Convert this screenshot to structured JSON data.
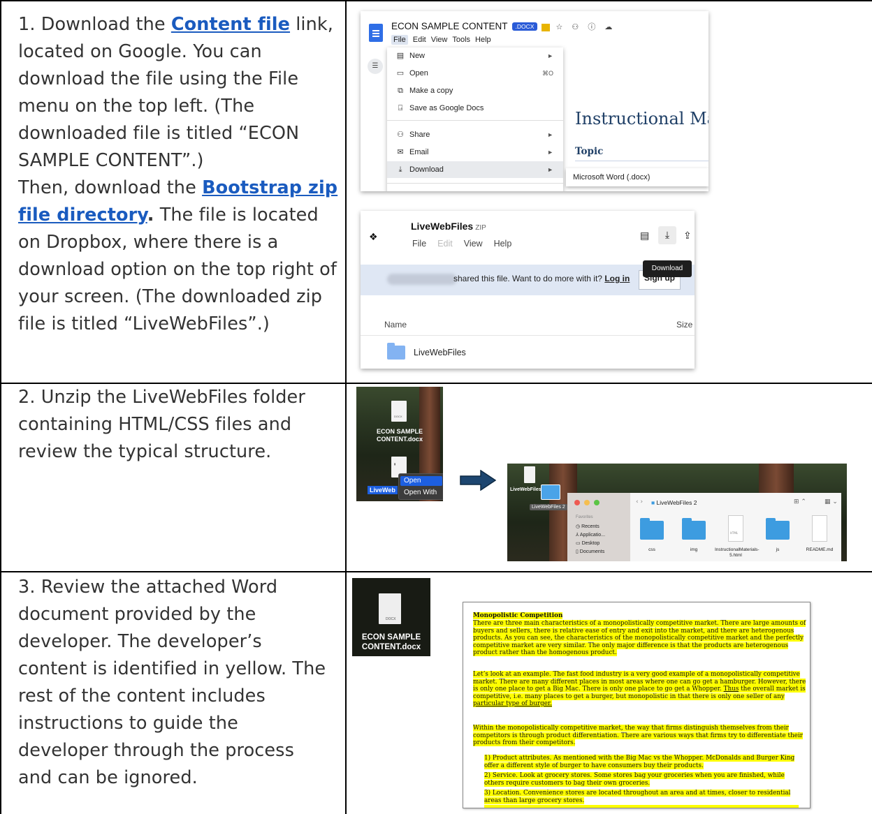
{
  "rows": [
    {
      "step": {
        "t1": "1. Download the ",
        "link1": "Content file",
        "t2": " link, located on Google. You can download the file using the File menu on the top left.  (The downloaded file is titled “ECON SAMPLE CONTENT”.)",
        "t3": "Then, download the ",
        "link2": "Bootstrap zip file directory",
        "t4": ".",
        "t5": "  The file is located on Dropbox, where there is a download option on the top right of your screen. (The downloaded zip file is titled “LiveWebFiles”.)"
      }
    },
    {
      "step": {
        "text": "2. Unzip the LiveWebFiles folder containing HTML/CSS files and review the typical structure."
      }
    },
    {
      "step": {
        "text": "3. Review the attached Word document provided by the developer. The developer’s content is identified in yellow. The rest of the content includes instructions to guide the developer through the process and can be ignored."
      }
    }
  ],
  "gdocs": {
    "title": "ECON SAMPLE CONTENT",
    "badge": ".DOCX",
    "menubar": [
      "File",
      "Edit",
      "View",
      "Tools",
      "Help"
    ],
    "menu": [
      {
        "icon": "▤",
        "label": "New",
        "right": "►"
      },
      {
        "icon": "▭",
        "label": "Open",
        "right": "⌘O"
      },
      {
        "icon": "⧉",
        "label": "Make a copy",
        "right": ""
      },
      {
        "icon": "⍈",
        "label": "Save as Google Docs",
        "right": ""
      },
      {
        "icon": "⚇",
        "label": "Share",
        "right": "►"
      },
      {
        "icon": "✉",
        "label": "Email",
        "right": "►"
      },
      {
        "icon": "⤓",
        "label": "Download",
        "right": "►"
      }
    ],
    "doc_heading": "Instructional Ma",
    "doc_topic": "Topic",
    "submenu_item": "Microsoft Word (.docx)"
  },
  "dropbox": {
    "name": "LiveWebFiles",
    "zip": "ZIP",
    "menu": [
      "File",
      "Edit",
      "View",
      "Help"
    ],
    "tooltip": "Download",
    "banner_text": "shared this file. Want to do more with it?",
    "login": "Log in",
    "signup": "Sign up",
    "col_name": "Name",
    "col_size": "Size",
    "folder": "LiveWebFiles"
  },
  "desktop1": {
    "file_tag": "DOCX",
    "file_label_1": "ECON SAMPLE",
    "file_label_2": "CONTENT.docx",
    "zip_label": "LiveWeb",
    "ctx_open": "Open",
    "ctx_open_with": "Open With"
  },
  "desktop2": {
    "desk_label": "LiveWebFiles",
    "drag_label": "LiveWebFiles 2",
    "finder_title": "LiveWebFiles 2",
    "sidebar_header": "Favorites",
    "sidebar": [
      "Recents",
      "Applicatio...",
      "Desktop",
      "Documents"
    ],
    "items": [
      "css",
      "img",
      "InstructionalMaterials-5.html",
      "js",
      "README.md"
    ],
    "html_tag": "HTML"
  },
  "desktop3": {
    "tag": "DOCX",
    "label_1": "ECON SAMPLE",
    "label_2": "CONTENT.docx"
  },
  "word": {
    "title": "Monopolistic Competition",
    "p1": "There are three main characteristics of a monopolistically competitive market.  There are large amounts of buyers and sellers, there is relative ease of entry and exit into the market, and there are heterogenous products.  As you can see, the characteristics of the monopolistically competitive market and the perfectly competitive market are very similar.  The only major difference is that the products are heterogenous product rather than the homogenous product.",
    "p2a": "Let’s look at an example.  The fast food industry is a very good example of a monopolistically competitive market.  There are many different places in most areas where one can go get a hamburger.  However, there is only one place to get a Big Mac.  There is only one place to go get a Whopper.  ",
    "p2b": "Thus",
    "p2c": " the overall market is competitive, i.e. many places to get a burger, but monopolistic in that there is only one seller of any ",
    "p2d": "particular type of burger.",
    "p3": "Within the monopolistically competitive market, the way that firms distinguish themselves from their competitors is through product differentiation.  There are various ways that firms try to differentiate their products from their competitors.",
    "li1": "1)    Product attributes.  As mentioned with the Big Mac vs the Whopper.  McDonalds and Burger King offer a different style of burger to have consumers buy their products.",
    "li2": "2)    Service.  Look at grocery stores.  Some stores bag your groceries when you are finished, while others require customers to bag their own groceries.",
    "li3": "3)    Location.  Convenience stores are located throughout an area and at times, closer to residential areas than large grocery stores."
  },
  "colors": {
    "link": "#1a5bbf",
    "border": "#000000",
    "highlight": "#ffff00"
  }
}
